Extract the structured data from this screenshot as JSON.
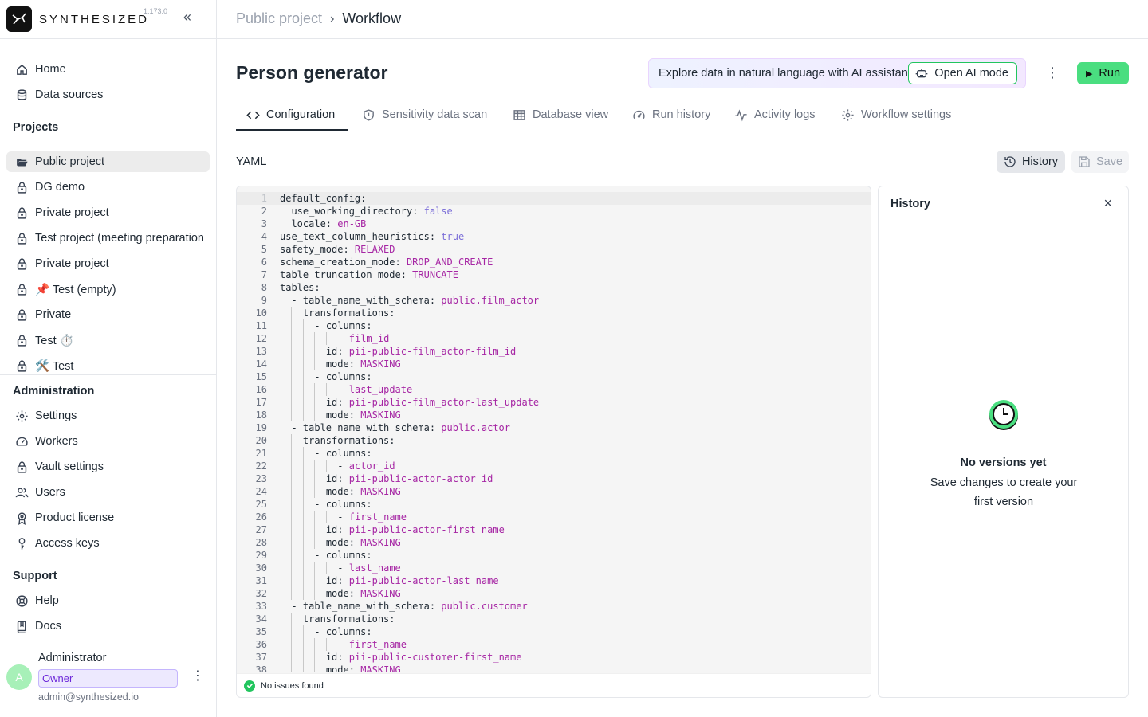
{
  "app": {
    "brand": "SYNTHESIZED",
    "version": "1.173.0",
    "collapse_icon": "double-chevron-left-icon"
  },
  "sidebar": {
    "nav": [
      {
        "label": "Home",
        "icon": "home-icon"
      },
      {
        "label": "Data sources",
        "icon": "database-icon"
      }
    ],
    "projects_heading": "Projects",
    "projects": [
      {
        "label": "Public project",
        "icon": "folder-open-icon",
        "active": true
      },
      {
        "label": "DG demo",
        "icon": "lock-icon"
      },
      {
        "label": "Private project",
        "icon": "lock-icon"
      },
      {
        "label": "Test project (meeting preparation",
        "icon": "lock-icon"
      },
      {
        "label": "Private project",
        "icon": "lock-icon"
      },
      {
        "label": "📌 Test (empty)",
        "icon": "lock-icon"
      },
      {
        "label": "Private",
        "icon": "lock-icon"
      },
      {
        "label": "Test ⏱️",
        "icon": "lock-icon"
      },
      {
        "label": "🛠️ Test",
        "icon": "lock-icon"
      }
    ],
    "admin_heading": "Administration",
    "admin": [
      {
        "label": "Settings",
        "icon": "gear-icon"
      },
      {
        "label": "Workers",
        "icon": "gauge-icon"
      },
      {
        "label": "Vault settings",
        "icon": "lock-icon"
      },
      {
        "label": "Users",
        "icon": "users-icon"
      },
      {
        "label": "Product license",
        "icon": "badge-icon"
      },
      {
        "label": "Access keys",
        "icon": "key-icon"
      }
    ],
    "support_heading": "Support",
    "support": [
      {
        "label": "Help",
        "icon": "lifebuoy-icon"
      },
      {
        "label": "Docs",
        "icon": "book-icon"
      }
    ],
    "user": {
      "initial": "A",
      "name": "Administrator",
      "role": "Owner",
      "email": "admin@synthesized.io"
    }
  },
  "header": {
    "breadcrumb_parent": "Public project",
    "breadcrumb_sep": "›",
    "breadcrumb_current": "Workflow"
  },
  "page": {
    "title": "Person generator",
    "ai_banner_text": "Explore data in natural language with AI assistant",
    "ai_button_label": "Open AI mode",
    "more_icon": "⋮",
    "run_label": "Run",
    "tabs": [
      {
        "label": "Configuration",
        "icon": "code-icon",
        "active": true
      },
      {
        "label": "Sensitivity data scan",
        "icon": "shield-icon"
      },
      {
        "label": "Database view",
        "icon": "table-icon"
      },
      {
        "label": "Run history",
        "icon": "speedometer-icon"
      },
      {
        "label": "Activity logs",
        "icon": "activity-icon"
      },
      {
        "label": "Workflow settings",
        "icon": "gear-icon"
      }
    ],
    "yaml_label": "YAML",
    "history_button_label": "History",
    "save_button_label": "Save"
  },
  "editor": {
    "status_text": "No issues found",
    "lines": [
      {
        "n": "1",
        "indent": 0,
        "key": "default_config:",
        "val": "",
        "vtype": ""
      },
      {
        "n": "2",
        "indent": 1,
        "key": "use_working_directory: ",
        "val": "false",
        "vtype": "bool"
      },
      {
        "n": "3",
        "indent": 1,
        "key": "locale: ",
        "val": "en-GB",
        "vtype": "str"
      },
      {
        "n": "4",
        "indent": 0,
        "key": "use_text_column_heuristics: ",
        "val": "true",
        "vtype": "bool"
      },
      {
        "n": "5",
        "indent": 0,
        "key": "safety_mode: ",
        "val": "RELAXED",
        "vtype": "str"
      },
      {
        "n": "6",
        "indent": 0,
        "key": "schema_creation_mode: ",
        "val": "DROP_AND_CREATE",
        "vtype": "str"
      },
      {
        "n": "7",
        "indent": 0,
        "key": "table_truncation_mode: ",
        "val": "TRUNCATE",
        "vtype": "str"
      },
      {
        "n": "8",
        "indent": 0,
        "key": "tables:",
        "val": "",
        "vtype": ""
      },
      {
        "n": "9",
        "indent": 1,
        "key": "- table_name_with_schema: ",
        "val": "public.film_actor",
        "vtype": "str"
      },
      {
        "n": "10",
        "indent": 2,
        "key": "transformations:",
        "val": "",
        "vtype": ""
      },
      {
        "n": "11",
        "indent": 3,
        "key": "- columns:",
        "val": "",
        "vtype": ""
      },
      {
        "n": "12",
        "indent": 5,
        "key": "- ",
        "val": "film_id",
        "vtype": "str"
      },
      {
        "n": "13",
        "indent": 4,
        "key": "id: ",
        "val": "pii-public-film_actor-film_id",
        "vtype": "str"
      },
      {
        "n": "14",
        "indent": 4,
        "key": "mode: ",
        "val": "MASKING",
        "vtype": "str"
      },
      {
        "n": "15",
        "indent": 3,
        "key": "- columns:",
        "val": "",
        "vtype": ""
      },
      {
        "n": "16",
        "indent": 5,
        "key": "- ",
        "val": "last_update",
        "vtype": "str"
      },
      {
        "n": "17",
        "indent": 4,
        "key": "id: ",
        "val": "pii-public-film_actor-last_update",
        "vtype": "str"
      },
      {
        "n": "18",
        "indent": 4,
        "key": "mode: ",
        "val": "MASKING",
        "vtype": "str"
      },
      {
        "n": "19",
        "indent": 1,
        "key": "- table_name_with_schema: ",
        "val": "public.actor",
        "vtype": "str"
      },
      {
        "n": "20",
        "indent": 2,
        "key": "transformations:",
        "val": "",
        "vtype": ""
      },
      {
        "n": "21",
        "indent": 3,
        "key": "- columns:",
        "val": "",
        "vtype": ""
      },
      {
        "n": "22",
        "indent": 5,
        "key": "- ",
        "val": "actor_id",
        "vtype": "str"
      },
      {
        "n": "23",
        "indent": 4,
        "key": "id: ",
        "val": "pii-public-actor-actor_id",
        "vtype": "str"
      },
      {
        "n": "24",
        "indent": 4,
        "key": "mode: ",
        "val": "MASKING",
        "vtype": "str"
      },
      {
        "n": "25",
        "indent": 3,
        "key": "- columns:",
        "val": "",
        "vtype": ""
      },
      {
        "n": "26",
        "indent": 5,
        "key": "- ",
        "val": "first_name",
        "vtype": "str"
      },
      {
        "n": "27",
        "indent": 4,
        "key": "id: ",
        "val": "pii-public-actor-first_name",
        "vtype": "str"
      },
      {
        "n": "28",
        "indent": 4,
        "key": "mode: ",
        "val": "MASKING",
        "vtype": "str"
      },
      {
        "n": "29",
        "indent": 3,
        "key": "- columns:",
        "val": "",
        "vtype": ""
      },
      {
        "n": "30",
        "indent": 5,
        "key": "- ",
        "val": "last_name",
        "vtype": "str"
      },
      {
        "n": "31",
        "indent": 4,
        "key": "id: ",
        "val": "pii-public-actor-last_name",
        "vtype": "str"
      },
      {
        "n": "32",
        "indent": 4,
        "key": "mode: ",
        "val": "MASKING",
        "vtype": "str"
      },
      {
        "n": "33",
        "indent": 1,
        "key": "- table_name_with_schema: ",
        "val": "public.customer",
        "vtype": "str"
      },
      {
        "n": "34",
        "indent": 2,
        "key": "transformations:",
        "val": "",
        "vtype": ""
      },
      {
        "n": "35",
        "indent": 3,
        "key": "- columns:",
        "val": "",
        "vtype": ""
      },
      {
        "n": "36",
        "indent": 5,
        "key": "- ",
        "val": "first_name",
        "vtype": "str"
      },
      {
        "n": "37",
        "indent": 4,
        "key": "id: ",
        "val": "pii-public-customer-first_name",
        "vtype": "str"
      },
      {
        "n": "38",
        "indent": 4,
        "key": "mode: ",
        "val": "MASKING",
        "vtype": "str"
      }
    ]
  },
  "history_panel": {
    "title": "History",
    "close_icon": "×",
    "empty_title": "No versions yet",
    "empty_desc": "Save changes to create your first version"
  },
  "colors": {
    "accent_green": "#4ade80",
    "string_value": "#a626a4",
    "bool_value": "#7c6fd8",
    "owner_badge": "#ede9fe"
  }
}
